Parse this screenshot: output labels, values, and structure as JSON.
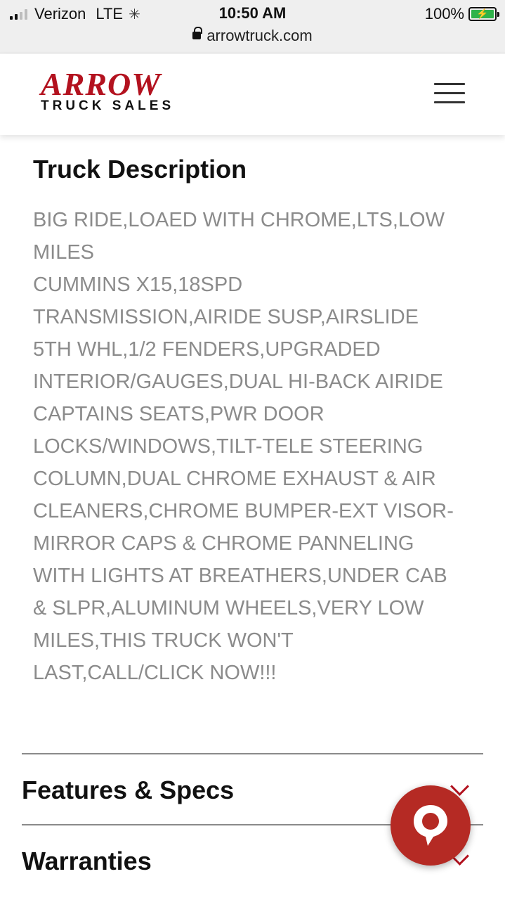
{
  "status_bar": {
    "carrier": "Verizon",
    "network": "LTE",
    "time": "10:50 AM",
    "battery": "100%",
    "url": "arrowtruck.com"
  },
  "header": {
    "logo_main": "ARROW",
    "logo_sub": "TRUCK SALES",
    "brand_color": "#b3121f",
    "menu_icon": "hamburger-menu-icon"
  },
  "truck_description": {
    "title": "Truck Description",
    "body": "BIG RIDE,LOAED WITH CHROME,LTS,LOW\nMILES\nCUMMINS X15,18SPD\nTRANSMISSION,AIRIDE SUSP,AIRSLIDE\n5TH WHL,1/2 FENDERS,UPGRADED\nINTERIOR/GAUGES,DUAL HI-BACK AIRIDE\nCAPTAINS SEATS,PWR DOOR\nLOCKS/WINDOWS,TILT-TELE STEERING\nCOLUMN,DUAL CHROME EXHAUST & AIR\nCLEANERS,CHROME BUMPER-EXT VISOR-\nMIRROR CAPS & CHROME PANNELING\nWITH LIGHTS AT BREATHERS,UNDER CAB\n& SLPR,ALUMINUM WHEELS,VERY LOW\nMILES,THIS TRUCK WON'T\nLAST,CALL/CLICK NOW!!!"
  },
  "accordion": [
    {
      "label": "Features & Specs",
      "icon": "chevron-down-icon"
    },
    {
      "label": "Warranties",
      "icon": "chevron-down-icon"
    }
  ],
  "chat_button": {
    "icon": "chat-bubble-icon",
    "color": "#b52a24"
  }
}
